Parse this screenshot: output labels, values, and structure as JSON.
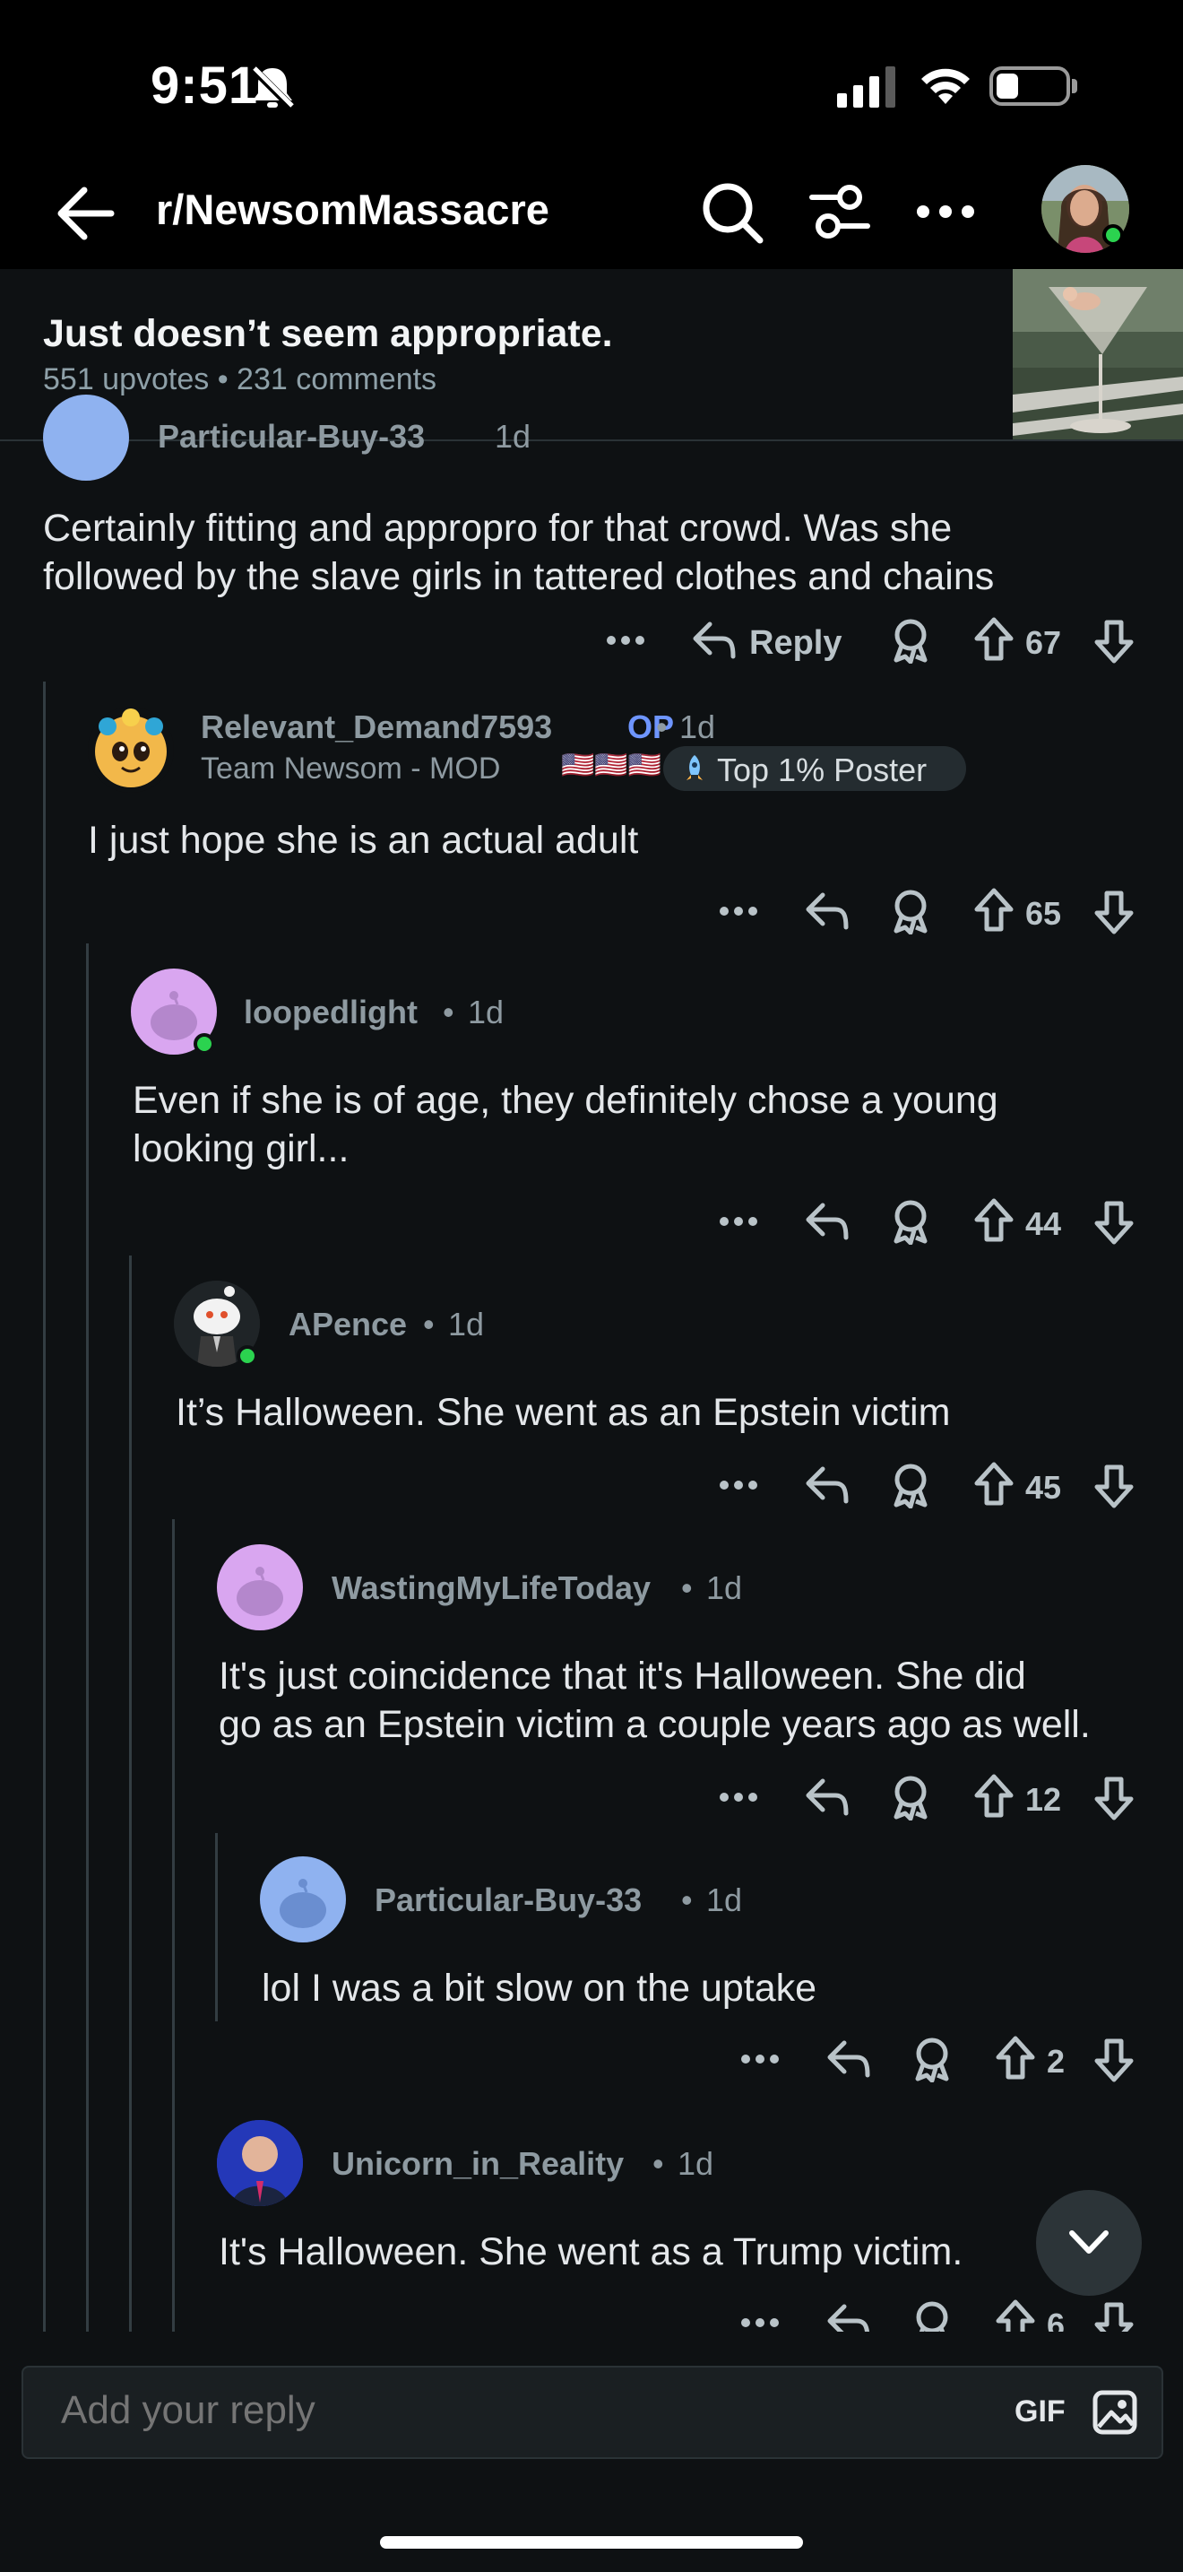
{
  "status_bar": {
    "time": "9:51"
  },
  "header": {
    "subreddit": "r/NewsomMassacre"
  },
  "post": {
    "title": "Just doesn’t seem appropriate.",
    "meta": "551 upvotes • 231 comments"
  },
  "comments": [
    {
      "username": "Particular-Buy-33",
      "age": "1d",
      "body_lines": [
        "Certainly fitting and appropro for that crowd.  Was she",
        "followed by the slave girls in tattered clothes and chains"
      ],
      "reply_label": "Reply",
      "score": "67"
    },
    {
      "username": "Relevant_Demand7593",
      "op_badge": "OP",
      "age": "1d",
      "flair": "Team Newsom - MOD",
      "flair_emoji": "🇺🇸🇺🇸🇺🇸",
      "achievement": "Top 1% Poster",
      "body_lines": [
        "I just hope she is an actual adult"
      ],
      "score": "65"
    },
    {
      "username": "loopedlight",
      "age": "1d",
      "body_lines": [
        "Even if she is of age, they definitely chose a young",
        "looking girl..."
      ],
      "score": "44"
    },
    {
      "username": "APence",
      "age": "1d",
      "body_lines": [
        "It’s Halloween. She went as an Epstein victim"
      ],
      "score": "45"
    },
    {
      "username": "WastingMyLifeToday",
      "age": "1d",
      "body_lines": [
        "It's just coincidence that it's Halloween. She did",
        "go as an Epstein victim a couple years ago as well."
      ],
      "score": "12"
    },
    {
      "username": "Particular-Buy-33",
      "age": "1d",
      "body_lines": [
        "lol I was a bit slow on the uptake"
      ],
      "score": "2"
    },
    {
      "username": "Unicorn_in_Reality",
      "age": "1d",
      "body_lines": [
        "It's Halloween. She went as a Trump victim."
      ],
      "score": "6"
    }
  ],
  "composer": {
    "placeholder": "Add your reply",
    "gif_label": "GIF"
  },
  "colors": {
    "background": "#0e1113",
    "op_badge": "#6e95ff",
    "online": "#2bd34f",
    "snoo_pink": "#d9a6f0",
    "snoo_blue": "#8fb2f0"
  }
}
